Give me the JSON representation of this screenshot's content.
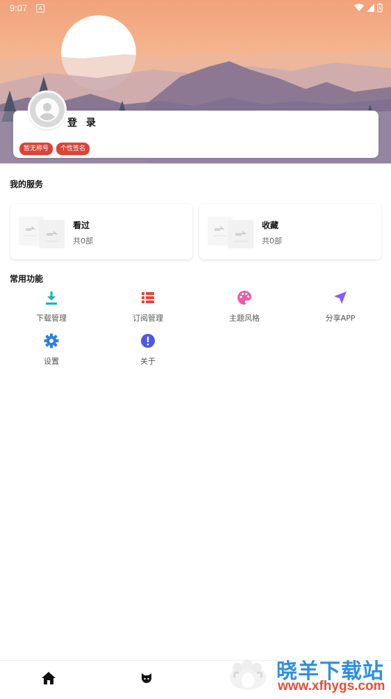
{
  "status_bar": {
    "time": "9:07",
    "sys_icon": "A"
  },
  "profile": {
    "login_label": "登 录",
    "tags": [
      "暂无称号",
      "个性签名"
    ]
  },
  "services": {
    "title": "我的服务",
    "items": [
      {
        "name": "看过",
        "count": "共0部"
      },
      {
        "name": "收藏",
        "count": "共0部"
      }
    ]
  },
  "functions": {
    "title": "常用功能",
    "items": [
      {
        "label": "下载管理",
        "icon": "download-icon",
        "color": "#16b3b8"
      },
      {
        "label": "订阅管理",
        "icon": "list-icon",
        "color": "#e0473c"
      },
      {
        "label": "主题风格",
        "icon": "palette-icon",
        "color": "#ea5aa8"
      },
      {
        "label": "分享APP",
        "icon": "send-icon",
        "color": "#8b5cf6"
      },
      {
        "label": "设置",
        "icon": "gear-icon",
        "color": "#2f7fe0"
      },
      {
        "label": "关于",
        "icon": "info-icon",
        "color": "#4f58e6"
      }
    ]
  },
  "watermark": {
    "title": "晓羊下载站",
    "url": "www.xfhygs.com"
  },
  "colors": {
    "accent": "#d9443a",
    "tag": "#d9443a"
  }
}
